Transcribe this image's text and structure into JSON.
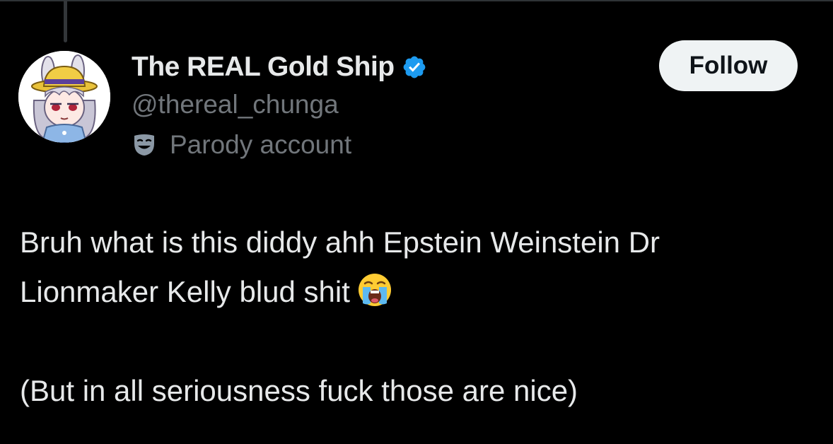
{
  "tweet": {
    "author": {
      "display_name": "The REAL Gold Ship",
      "handle": "@thereal_chunga",
      "verified": true,
      "verified_color": "#1d9bf0",
      "label_icon": "theater-mask-icon",
      "label": "Parody account",
      "avatar_icon": "anime-character-avatar"
    },
    "follow_label": "Follow",
    "text": {
      "line1": "Bruh what is this diddy ahh Epstein Weinstein Dr",
      "line2": "Lionmaker Kelly blud shit",
      "emoji": "loudly-crying-face-emoji",
      "line3": "(But in all seriousness fuck those are nice)"
    }
  },
  "colors": {
    "background": "#000000",
    "primary_text": "#e7e9ea",
    "secondary_text": "#71767b",
    "button_bg": "#eff3f4",
    "button_text": "#0f1419"
  }
}
